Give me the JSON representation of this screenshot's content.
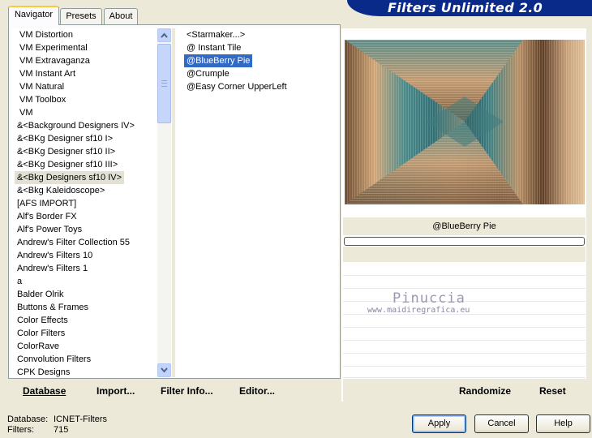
{
  "app": {
    "title": "Filters Unlimited 2.0"
  },
  "tabs": [
    "Navigator",
    "Presets",
    "About"
  ],
  "categories": [
    "VM Distortion",
    "VM Experimental",
    "VM Extravaganza",
    "VM Instant Art",
    "VM Natural",
    "VM Toolbox",
    "VM",
    "&<Background Designers IV>",
    "&<BKg Designer sf10 I>",
    "&<BKg Designer sf10 II>",
    "&<BKg Designer sf10 III>",
    "&<Bkg Designers sf10 IV>",
    "&<Bkg Kaleidoscope>",
    "[AFS IMPORT]",
    "Alf's Border FX",
    "Alf's Power Toys",
    "Andrew's Filter Collection 55",
    "Andrew's Filters 10",
    "Andrew's Filters 1",
    "a",
    "Balder Olrik",
    "Buttons & Frames",
    "Color Effects",
    "Color Filters",
    "ColorRave",
    "Convolution Filters",
    "CPK Designs"
  ],
  "selected_category": "&<Bkg Designers sf10 IV>",
  "filters": [
    "<Starmaker...>",
    "@ Instant Tile",
    "@BlueBerry Pie",
    "@Crumple",
    "@Easy Corner UpperLeft"
  ],
  "selected_filter": "@BlueBerry Pie",
  "preview": {
    "filter_name": "@BlueBerry Pie"
  },
  "watermark": {
    "name": "Pinuccia",
    "url": "www.maidiregrafica.eu"
  },
  "links": {
    "database": "Database",
    "import": "Import...",
    "filter_info": "Filter Info...",
    "editor": "Editor..."
  },
  "right_buttons": {
    "randomize": "Randomize",
    "reset": "Reset"
  },
  "status": {
    "database_label": "Database:",
    "database_value": "ICNET-Filters",
    "filters_label": "Filters:",
    "filters_value": "715"
  },
  "buttons": {
    "apply": "Apply",
    "cancel": "Cancel",
    "help": "Help"
  },
  "colors": {
    "banner": "#0a2a8a",
    "selection": "#316ac5",
    "window": "#ece9d8",
    "tab_highlight": "#ffc83c"
  }
}
